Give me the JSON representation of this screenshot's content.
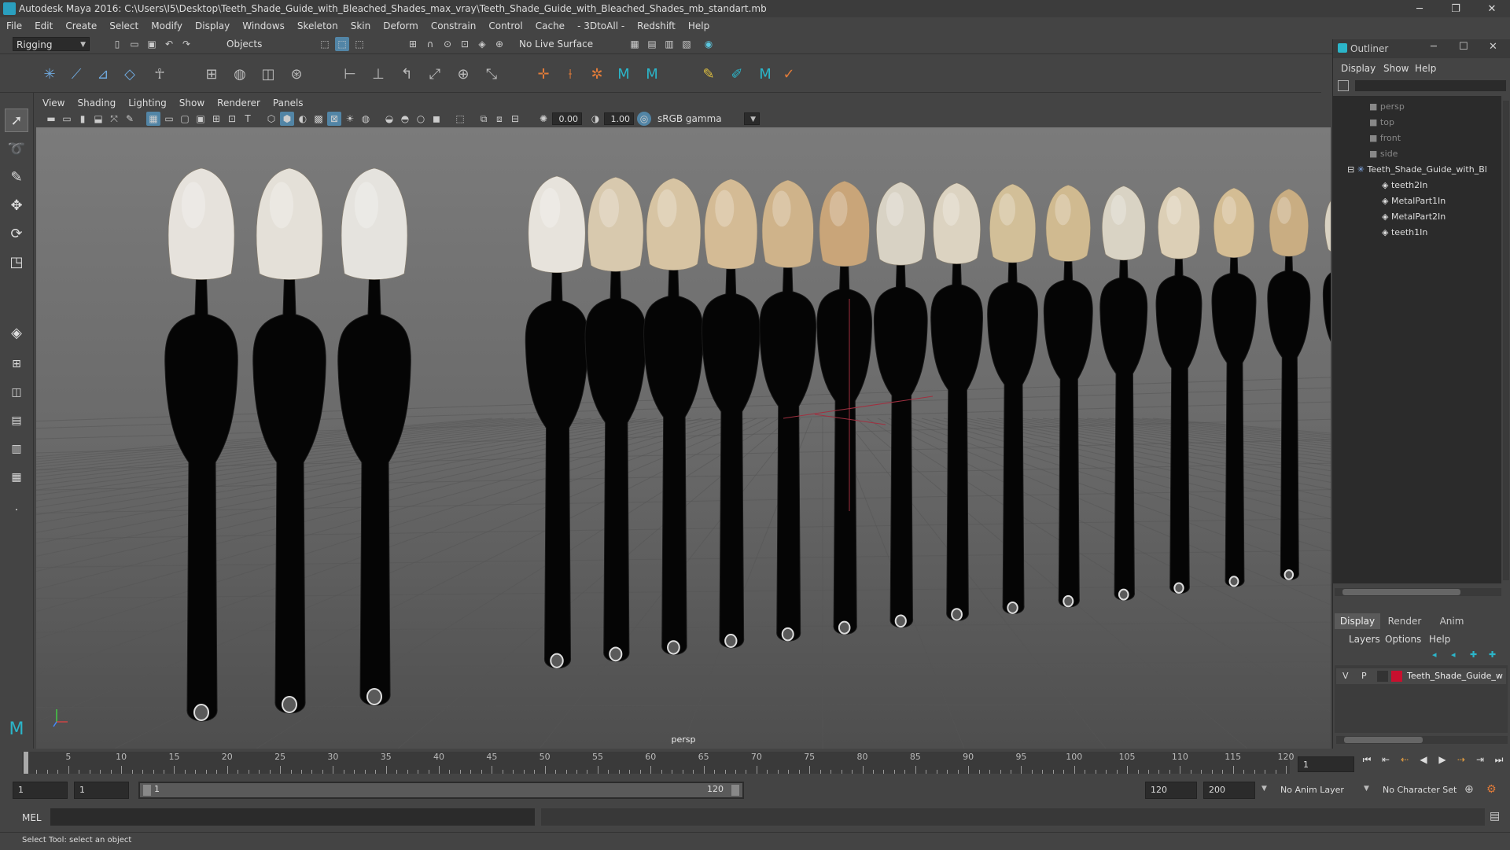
{
  "titlebar": {
    "title": "Autodesk Maya 2016: C:\\Users\\I5\\Desktop\\Teeth_Shade_Guide_with_Bleached_Shades_max_vray\\Teeth_Shade_Guide_with_Bleached_Shades_mb_standart.mb"
  },
  "menus": [
    "File",
    "Edit",
    "Create",
    "Select",
    "Modify",
    "Display",
    "Windows",
    "Skeleton",
    "Skin",
    "Deform",
    "Constrain",
    "Control",
    "Cache",
    "- 3DtoAll -",
    "Redshift",
    "Help"
  ],
  "statusline": {
    "menuset": "Rigging",
    "selection_mode": "Objects",
    "live_surface": "No Live Surface"
  },
  "viewport": {
    "menus": [
      "View",
      "Shading",
      "Lighting",
      "Show",
      "Renderer",
      "Panels"
    ],
    "near_value": "0.00",
    "far_value": "1.00",
    "color_space": "sRGB gamma",
    "camera_label": "persp",
    "tab_colors": [
      "#e6e2dc",
      "#e4e0d8",
      "#e5e3de",
      "#e7e3dc",
      "#d8c9ae",
      "#d7c4a3",
      "#d4bb95",
      "#cfb38a",
      "#c9a579",
      "#d8d2c4",
      "#dcd3c1",
      "#d2bf98",
      "#d0ba90",
      "#d9d3c4",
      "#dccfb6",
      "#d4bd94",
      "#c9ad82",
      "#d9d2c2",
      "#dcd2bb",
      "#d7c7a4"
    ]
  },
  "outliner": {
    "title": "Outliner",
    "menu": [
      "Display",
      "Show",
      "Help"
    ],
    "cameras": [
      "persp",
      "top",
      "front",
      "side"
    ],
    "group": "Teeth_Shade_Guide_with_Bl",
    "children": [
      "teeth2In",
      "MetalPart1In",
      "MetalPart2In",
      "teeth1In"
    ]
  },
  "layers": {
    "tabs": [
      "Display",
      "Render",
      "Anim"
    ],
    "menu": [
      "Layers",
      "Options",
      "Help"
    ],
    "layer": {
      "v": "V",
      "p": "P",
      "name": "Teeth_Shade_Guide_w",
      "color": "#c8102e"
    }
  },
  "timeline": {
    "labels": [
      "5",
      "10",
      "15",
      "20",
      "25",
      "30",
      "35",
      "40",
      "45",
      "50",
      "55",
      "60",
      "65",
      "70",
      "75",
      "80",
      "85",
      "90",
      "95",
      "100",
      "105",
      "110",
      "115",
      "120"
    ],
    "current_frame": "1",
    "start_first": "1",
    "start_second": "1",
    "range_start": "1",
    "range_end": "120",
    "end_first": "120",
    "end_second": "200",
    "anim_layer": "No Anim Layer",
    "char_set": "No Character Set"
  },
  "cmdline": {
    "lang": "MEL"
  },
  "helpline": {
    "text": "Select Tool: select an object"
  }
}
